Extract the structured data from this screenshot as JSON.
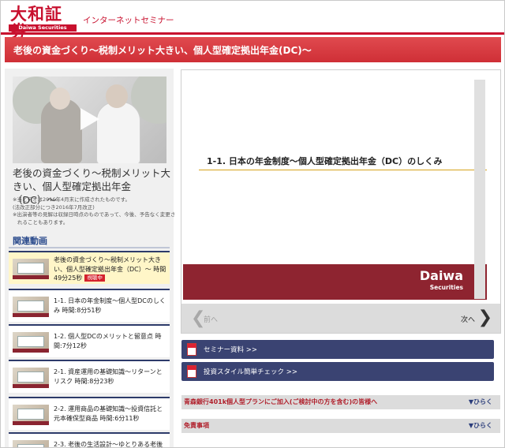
{
  "header": {
    "logo_jp": "大和証券",
    "logo_en": "Daiwa Securities",
    "site_label": "インターネットセミナー"
  },
  "banner": {
    "title": "老後の資金づくり〜税制メリット大きい、個人型確定拠出年金(DC)〜"
  },
  "video": {
    "title": "老後の資金づくり〜税制メリット大きい、個人型確定拠出年金（DC）〜",
    "notes": [
      "※当ビデオは2016年4月末に作成されたものです。",
      "(法改正部分につき2016年7月改正)",
      "※出演者等の見解は収録日時点のものであって、今後、予告なく変更さ",
      "れることもあります。"
    ]
  },
  "related": {
    "heading": "関連動画",
    "items": [
      {
        "text": "老後の資金づくり〜税制メリット大きい、個人型確定拠出年金（DC）〜 時間49分25秒",
        "badge": "視聴中"
      },
      {
        "text": "1-1. 日本の年金制度〜個人型DCのしくみ 時間:8分51秒",
        "badge": ""
      },
      {
        "text": "1-2. 個人型DCのメリットと留意点 時間:7分12秒",
        "badge": ""
      },
      {
        "text": "2-1. 資産運用の基礎知識〜リターンとリスク 時間:8分23秒",
        "badge": ""
      },
      {
        "text": "2-2. 運用商品の基礎知識〜投資信託と元本確保型商品 時間:6分11秒",
        "badge": ""
      },
      {
        "text": "2-3. 老後の生活設計〜ゆとりある老後生",
        "badge": ""
      }
    ]
  },
  "slide": {
    "title": "1-1. 日本の年金制度〜個人型確定拠出年金（DC）のしくみ",
    "logo_main": "Daiwa",
    "logo_sub": "Securities",
    "prev_label": "前へ",
    "next_label": "次へ"
  },
  "links": {
    "seminar": "セミナー資料 >>",
    "check": "投資スタイル簡単チェック >>"
  },
  "accordions": [
    {
      "label": "青森銀行401k個人型プランにご加入(ご検討中の方を含む)の皆様へ",
      "toggle": "▼ひらく"
    },
    {
      "label": "免責事項",
      "toggle": "▼ひらく"
    }
  ],
  "colors": {
    "brand_red": "#c8102e",
    "banner_red": "#d93a40",
    "navy": "#3a4372",
    "slide_footer": "#8e2430",
    "accent_gold": "#d6a31c"
  }
}
